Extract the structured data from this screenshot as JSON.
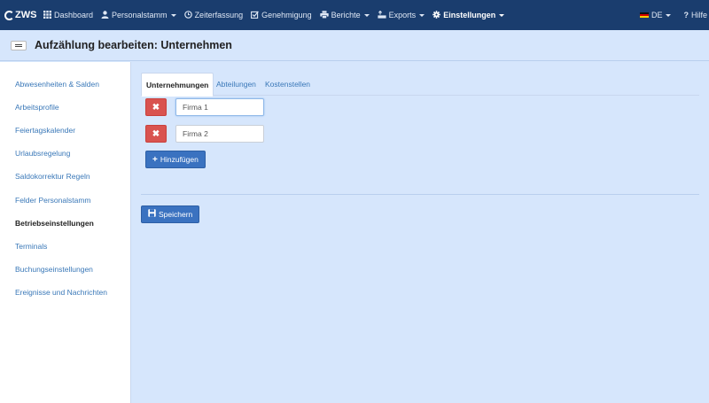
{
  "navbar": {
    "brand": "ZWS",
    "items": [
      {
        "label": "Dashboard",
        "icon": "grid-icon"
      },
      {
        "label": "Personalstamm",
        "icon": "user-icon",
        "dropdown": true
      },
      {
        "label": "Zeiterfassung",
        "icon": "clock-icon"
      },
      {
        "label": "Genehmigung",
        "icon": "check-square-icon"
      },
      {
        "label": "Berichte",
        "icon": "printer-icon",
        "dropdown": true
      },
      {
        "label": "Exports",
        "icon": "export-icon",
        "dropdown": true
      },
      {
        "label": "Einstellungen",
        "icon": "gear-icon",
        "dropdown": true,
        "active": true
      }
    ],
    "language": "DE",
    "help": "Hilfe",
    "bg_color": "#1a3d6e"
  },
  "page": {
    "title": "Aufzählung bearbeiten: Unternehmen"
  },
  "sidebar": {
    "items": [
      {
        "label": "Abwesenheiten & Salden"
      },
      {
        "label": "Arbeitsprofile"
      },
      {
        "label": "Feiertagskalender"
      },
      {
        "label": "Urlaubsregelung"
      },
      {
        "label": "Saldokorrektur Regeln"
      },
      {
        "label": "Felder Personalstamm"
      },
      {
        "label": "Betriebseinstellungen",
        "active": true
      },
      {
        "label": "Terminals"
      },
      {
        "label": "Buchungseinstellungen"
      },
      {
        "label": "Ereignisse und Nachrichten"
      }
    ]
  },
  "tabs": [
    {
      "label": "Unternehmungen",
      "active": true
    },
    {
      "label": "Abteilungen"
    },
    {
      "label": "Kostenstellen"
    }
  ],
  "entries": [
    {
      "value": "Firma 1"
    },
    {
      "value": "Firma 2"
    }
  ],
  "buttons": {
    "add": "Hinzufügen",
    "save": "Speichern"
  },
  "colors": {
    "danger": "#d9534f",
    "primary": "#3a72c0",
    "page_bg": "#d6e6fc"
  }
}
